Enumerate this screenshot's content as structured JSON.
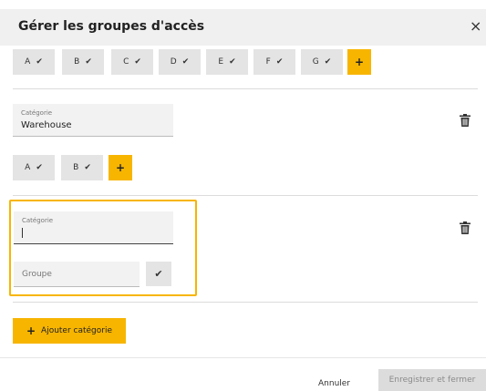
{
  "dialog": {
    "title": "Gérer les groupes d'accès",
    "close_glyph": "×"
  },
  "section1": {
    "groups": [
      {
        "label": "A"
      },
      {
        "label": "B"
      },
      {
        "label": "C"
      },
      {
        "label": "D"
      },
      {
        "label": "E"
      },
      {
        "label": "F"
      },
      {
        "label": "G"
      }
    ],
    "add_glyph": "+"
  },
  "section2": {
    "category_label": "Catégorie",
    "category_value": "Warehouse",
    "groups": [
      {
        "label": "A"
      },
      {
        "label": "B"
      }
    ],
    "add_glyph": "+"
  },
  "section3": {
    "category_label": "Catégorie",
    "category_value": "",
    "group_placeholder": "Groupe",
    "confirm_glyph": "✔"
  },
  "actions": {
    "add_category_glyph": "+",
    "add_category_label": "Ajouter catégorie",
    "cancel_label": "Annuler",
    "save_label": "Enregistrer et fermer"
  },
  "icons": {
    "check": "check-icon",
    "trash": "trash-icon",
    "close": "close-icon",
    "plus": "plus-icon"
  },
  "colors": {
    "accent": "#f7b500",
    "chip_bg": "#e4e4e4",
    "header_bg": "#f0f0f0"
  }
}
